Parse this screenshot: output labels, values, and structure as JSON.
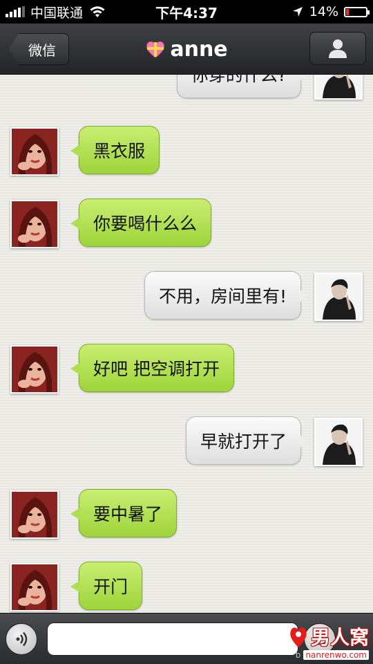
{
  "status_bar": {
    "carrier": "中国联通",
    "time": "下午4:37",
    "battery_percent": "14%",
    "battery_level": 0.14,
    "icons": [
      "signal-icon",
      "wifi-icon",
      "location-arrow-icon",
      "battery-icon"
    ]
  },
  "nav": {
    "back_label": "微信",
    "title": "anne",
    "title_icon": "heart-gift-icon",
    "profile_icon": "person-icon"
  },
  "messages": [
    {
      "side": "right",
      "text": "你穿的什么?",
      "avatar": "avatar-man"
    },
    {
      "side": "left",
      "text": "黑衣服",
      "avatar": "avatar-anne"
    },
    {
      "side": "left",
      "text": "你要喝什么么",
      "avatar": "avatar-anne"
    },
    {
      "side": "right",
      "text": "不用，房间里有!",
      "avatar": "avatar-man"
    },
    {
      "side": "left",
      "text": "好吧 把空调打开",
      "avatar": "avatar-anne"
    },
    {
      "side": "right",
      "text": "早就打开了",
      "avatar": "avatar-man"
    },
    {
      "side": "left",
      "text": "要中暑了",
      "avatar": "avatar-anne"
    },
    {
      "side": "left",
      "text": "开门",
      "avatar": "avatar-anne"
    }
  ],
  "input_bar": {
    "placeholder": "",
    "value": "",
    "voice_icon": "voice-icon",
    "emoji_icon": "emoji-icon"
  },
  "watermark": {
    "title": "男人窝",
    "url": "nanrenwo.com",
    "prefix": "b"
  },
  "colors": {
    "left_bubble": "#b0de52",
    "right_bubble": "#ececec",
    "nav_bg": "#2e3033",
    "battery_low": "#e33333"
  }
}
